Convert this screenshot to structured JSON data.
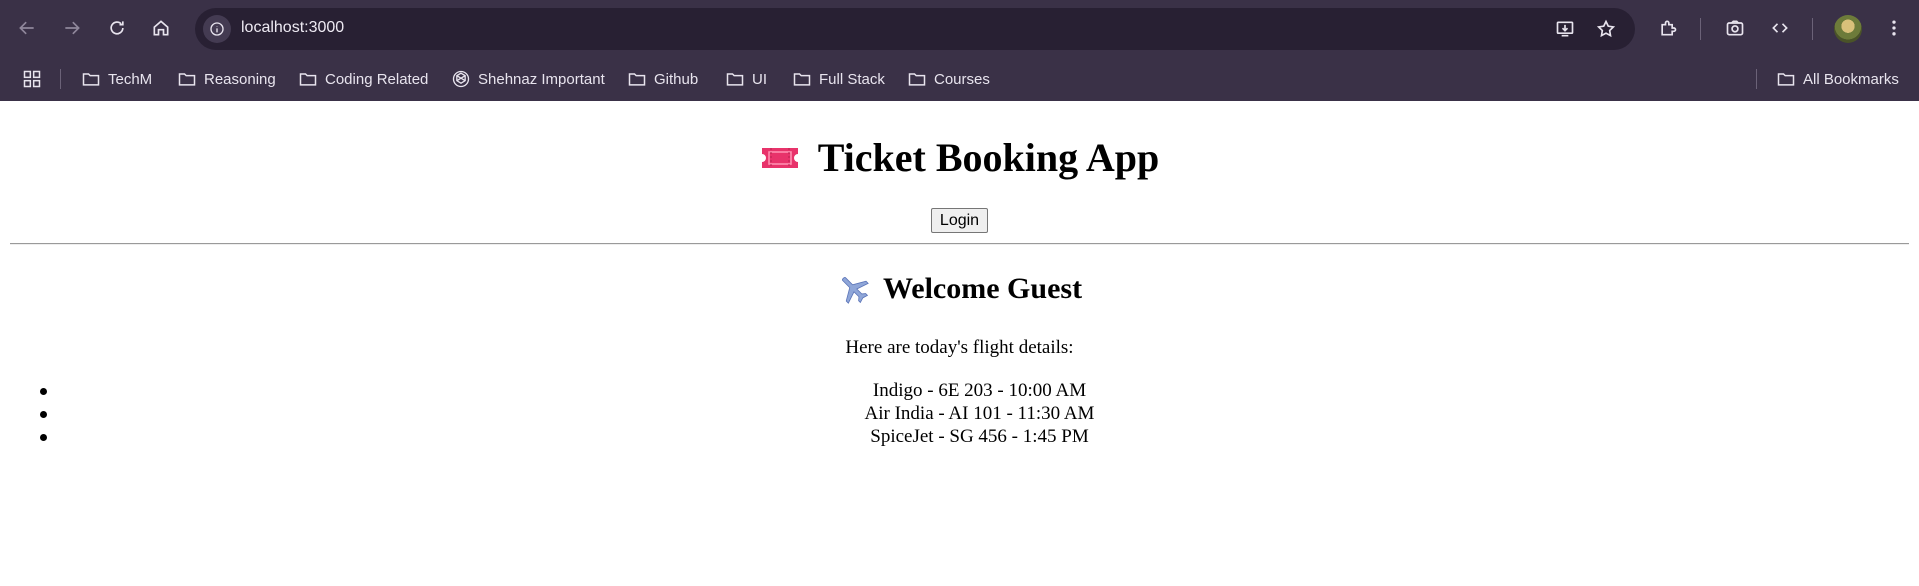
{
  "browser": {
    "url": "localhost:3000",
    "bookmarks": [
      {
        "label": "TechM",
        "icon": "folder-icon"
      },
      {
        "label": "Reasoning",
        "icon": "folder-icon"
      },
      {
        "label": "Coding Related",
        "icon": "folder-icon"
      },
      {
        "label": "Shehnaz Important",
        "icon": "openai-icon"
      },
      {
        "label": "Github",
        "icon": "folder-icon"
      },
      {
        "label": "UI",
        "icon": "folder-icon"
      },
      {
        "label": "Full Stack",
        "icon": "folder-icon"
      },
      {
        "label": "Courses",
        "icon": "folder-icon"
      }
    ],
    "all_bookmarks_label": "All Bookmarks",
    "colors": {
      "chrome": "#3a3147",
      "omnibox": "#282033"
    }
  },
  "app": {
    "title": "Ticket Booking App",
    "title_icon": "ticket-icon",
    "login_label": "Login",
    "welcome": "Welcome Guest",
    "welcome_icon": "airplane-icon",
    "subtitle": "Here are today's flight details:",
    "flights": [
      "Indigo - 6E 203 - 10:00 AM",
      "Air India - AI 101 - 11:30 AM",
      "SpiceJet - SG 456 - 1:45 PM"
    ]
  }
}
